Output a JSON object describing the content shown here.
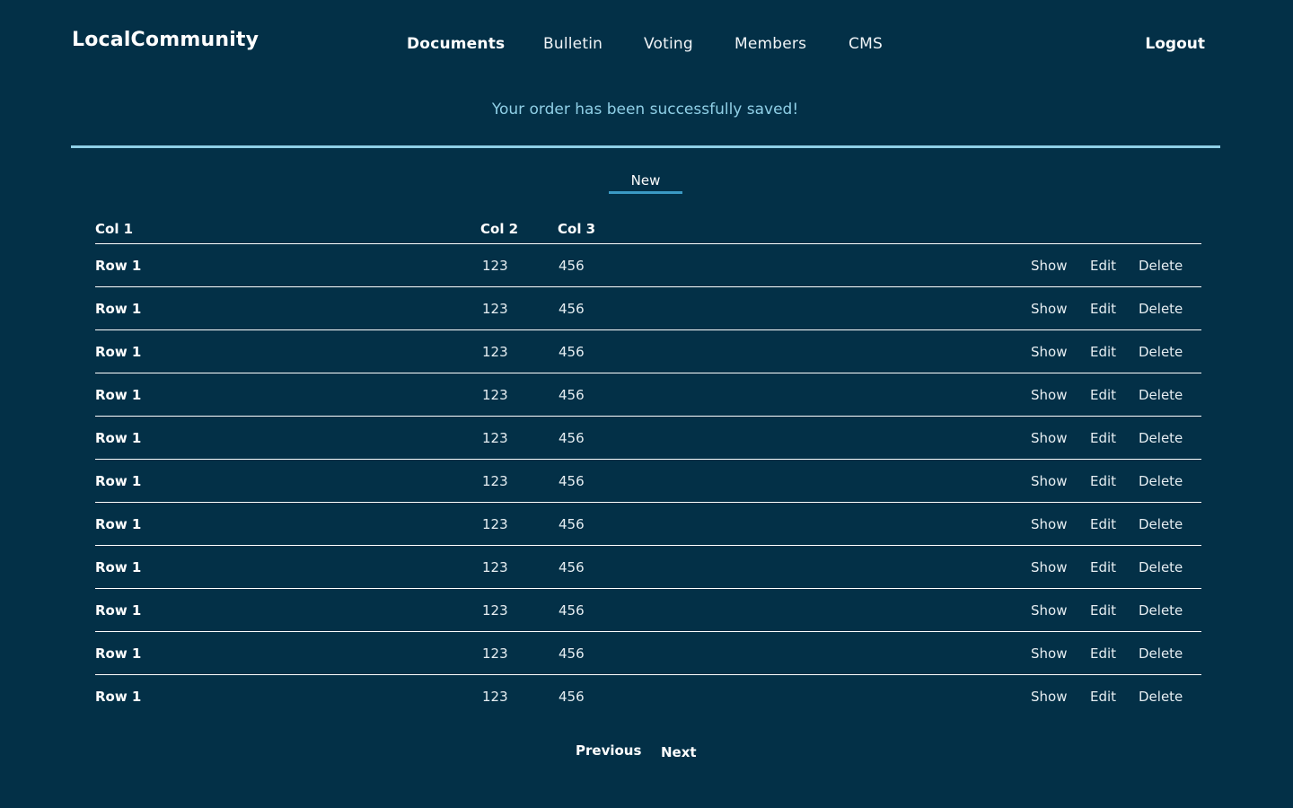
{
  "brand": "LocalCommunity",
  "nav": {
    "items": [
      {
        "label": "Documents",
        "active": true
      },
      {
        "label": "Bulletin",
        "active": false
      },
      {
        "label": "Voting",
        "active": false
      },
      {
        "label": "Members",
        "active": false
      },
      {
        "label": "CMS",
        "active": false
      }
    ],
    "logout": "Logout"
  },
  "flash": {
    "message": "Your order has been successfully saved!",
    "color": "#8fcfe6"
  },
  "tabs": {
    "new_label": "New"
  },
  "table": {
    "headers": [
      "Col 1",
      "Col 2",
      "Col 3"
    ],
    "actions": [
      "Show",
      "Edit",
      "Delete"
    ],
    "rows": [
      [
        "Row 1",
        "123",
        "456"
      ],
      [
        "Row 1",
        "123",
        "456"
      ],
      [
        "Row 1",
        "123",
        "456"
      ],
      [
        "Row 1",
        "123",
        "456"
      ],
      [
        "Row 1",
        "123",
        "456"
      ],
      [
        "Row 1",
        "123",
        "456"
      ],
      [
        "Row 1",
        "123",
        "456"
      ],
      [
        "Row 1",
        "123",
        "456"
      ],
      [
        "Row 1",
        "123",
        "456"
      ],
      [
        "Row 1",
        "123",
        "456"
      ],
      [
        "Row 1",
        "123",
        "456"
      ]
    ]
  },
  "pagination": {
    "previous": "Previous",
    "next": "Next"
  },
  "colors": {
    "background": "#033047",
    "accent": "#3b9ac4"
  }
}
